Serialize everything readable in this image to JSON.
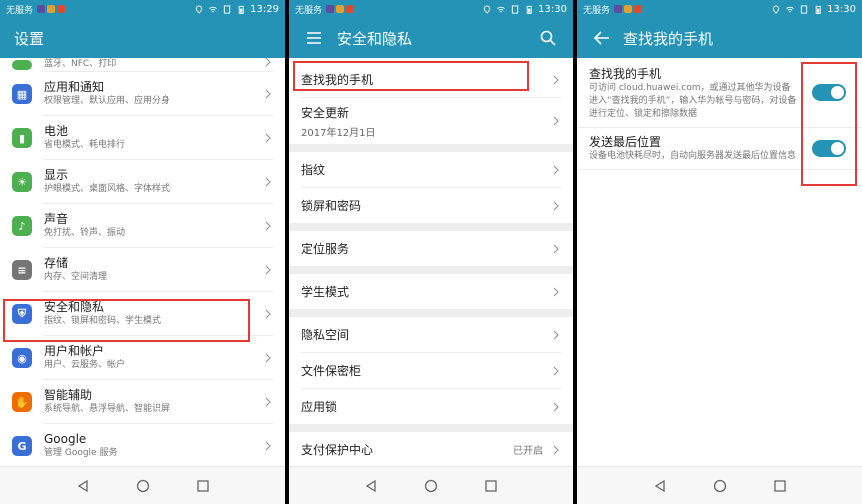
{
  "colors": {
    "accent": "#2493b5",
    "highlight": "#e53935"
  },
  "panels": [
    {
      "status": {
        "carrier": "无服务",
        "time": "13:29"
      },
      "title": "设置",
      "partial_item": {
        "subtitle": "蓝牙、NFC、打印"
      },
      "items": [
        {
          "title": "应用和通知",
          "subtitle": "权限管理、默认应用、应用分身",
          "icon": "apps-icon",
          "color": "#3b6fd8"
        },
        {
          "title": "电池",
          "subtitle": "省电模式、耗电排行",
          "icon": "battery-icon",
          "color": "#4caf50"
        },
        {
          "title": "显示",
          "subtitle": "护眼模式、桌面风格、字体样式",
          "icon": "display-icon",
          "color": "#4caf50"
        },
        {
          "title": "声音",
          "subtitle": "免打扰、铃声、振动",
          "icon": "sound-icon",
          "color": "#4caf50"
        },
        {
          "title": "存储",
          "subtitle": "内存、空间清理",
          "icon": "storage-icon",
          "color": "#757575"
        },
        {
          "title": "安全和隐私",
          "subtitle": "指纹、锁屏和密码、学生模式",
          "icon": "shield-icon",
          "color": "#3b6fd8"
        },
        {
          "title": "用户和帐户",
          "subtitle": "用户、云服务、帐户",
          "icon": "user-icon",
          "color": "#3b6fd8"
        },
        {
          "title": "智能辅助",
          "subtitle": "系统导航、悬浮导航、智能识屏",
          "icon": "hand-icon",
          "color": "#ef6c00"
        },
        {
          "title": "Google",
          "subtitle": "管理 Google 服务",
          "icon": "google-icon",
          "color": "#3b6fd8"
        }
      ]
    },
    {
      "status": {
        "carrier": "无服务",
        "time": "13:30"
      },
      "title": "安全和隐私",
      "items": [
        {
          "title": "查找我的手机"
        },
        {
          "title": "安全更新",
          "subtitle": "2017年12月1日"
        },
        {
          "title": "指纹"
        },
        {
          "title": "锁屏和密码"
        },
        {
          "title": "定位服务"
        },
        {
          "title": "学生模式"
        },
        {
          "title": "隐私空间"
        },
        {
          "title": "文件保密柜"
        },
        {
          "title": "应用锁"
        },
        {
          "title": "支付保护中心",
          "value": "已开启"
        }
      ]
    },
    {
      "status": {
        "carrier": "无服务",
        "time": "13:30"
      },
      "title": "查找我的手机",
      "items": [
        {
          "title": "查找我的手机",
          "description": "可访问 cloud.huawei.com，或通过其他华为设备进入“查找我的手机”，输入华为帐号与密码，对设备进行定位、锁定和擦除数据",
          "enabled": true
        },
        {
          "title": "发送最后位置",
          "description": "设备电池快耗尽时，自动向服务器发送最后位置信息",
          "enabled": true
        }
      ]
    }
  ]
}
